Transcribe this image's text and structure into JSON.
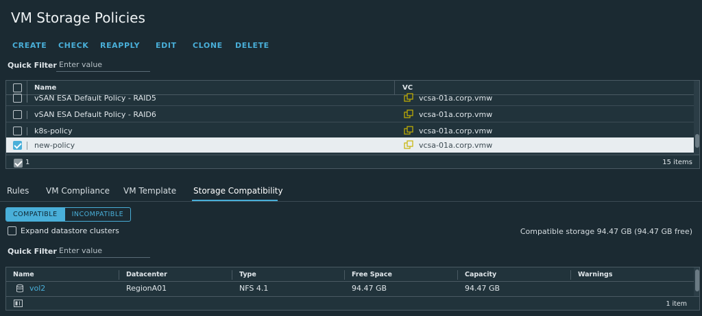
{
  "page": {
    "title": "VM Storage Policies"
  },
  "toolbar": {
    "create": "CREATE",
    "check": "CHECK",
    "reapply": "REAPPLY",
    "edit": "EDIT",
    "clone": "CLONE",
    "delete": "DELETE"
  },
  "filter_top": {
    "label": "Quick Filter",
    "placeholder": "Enter value"
  },
  "policy_grid": {
    "columns": {
      "name": "Name",
      "vc": "VC"
    },
    "rows": [
      {
        "name": "vSAN ESA Default Policy - RAID5",
        "vc": "vcsa-01a.corp.vmw",
        "checked": false
      },
      {
        "name": "vSAN ESA Default Policy - RAID6",
        "vc": "vcsa-01a.corp.vmw",
        "checked": false
      },
      {
        "name": "k8s-policy",
        "vc": "vcsa-01a.corp.vmw",
        "checked": false
      },
      {
        "name": "new-policy",
        "vc": "vcsa-01a.corp.vmw",
        "checked": true
      }
    ],
    "selected_count": "1",
    "total": "15 items",
    "vc_icon": "vcenter-icon",
    "colors": {
      "vc_icon": "#c8b400",
      "selected_row": "#e8edf0"
    }
  },
  "tabs": {
    "rules": "Rules",
    "vm_compliance": "VM Compliance",
    "vm_template": "VM Template",
    "storage_compat": "Storage Compatibility"
  },
  "segment": {
    "compatible": "COMPATIBLE",
    "incompatible": "INCOMPATIBLE"
  },
  "expand": {
    "label": "Expand datastore clusters"
  },
  "compat_summary": "Compatible storage 94.47 GB (94.47 GB free)",
  "filter_bottom": {
    "label": "Quick Filter",
    "placeholder": "Enter value"
  },
  "storage_grid": {
    "columns": {
      "name": "Name",
      "datacenter": "Datacenter",
      "type": "Type",
      "free": "Free Space",
      "capacity": "Capacity",
      "warnings": "Warnings"
    },
    "row": {
      "name": "vol2",
      "datacenter": "RegionA01",
      "type": "NFS 4.1",
      "free": "94.47 GB",
      "capacity": "94.47 GB",
      "warnings": ""
    },
    "total": "1 item",
    "icons": {
      "datastore": "datastore-icon",
      "columns": "column-toggle-icon"
    }
  },
  "colors": {
    "accent": "#49afd9",
    "background": "#1b2a32"
  }
}
